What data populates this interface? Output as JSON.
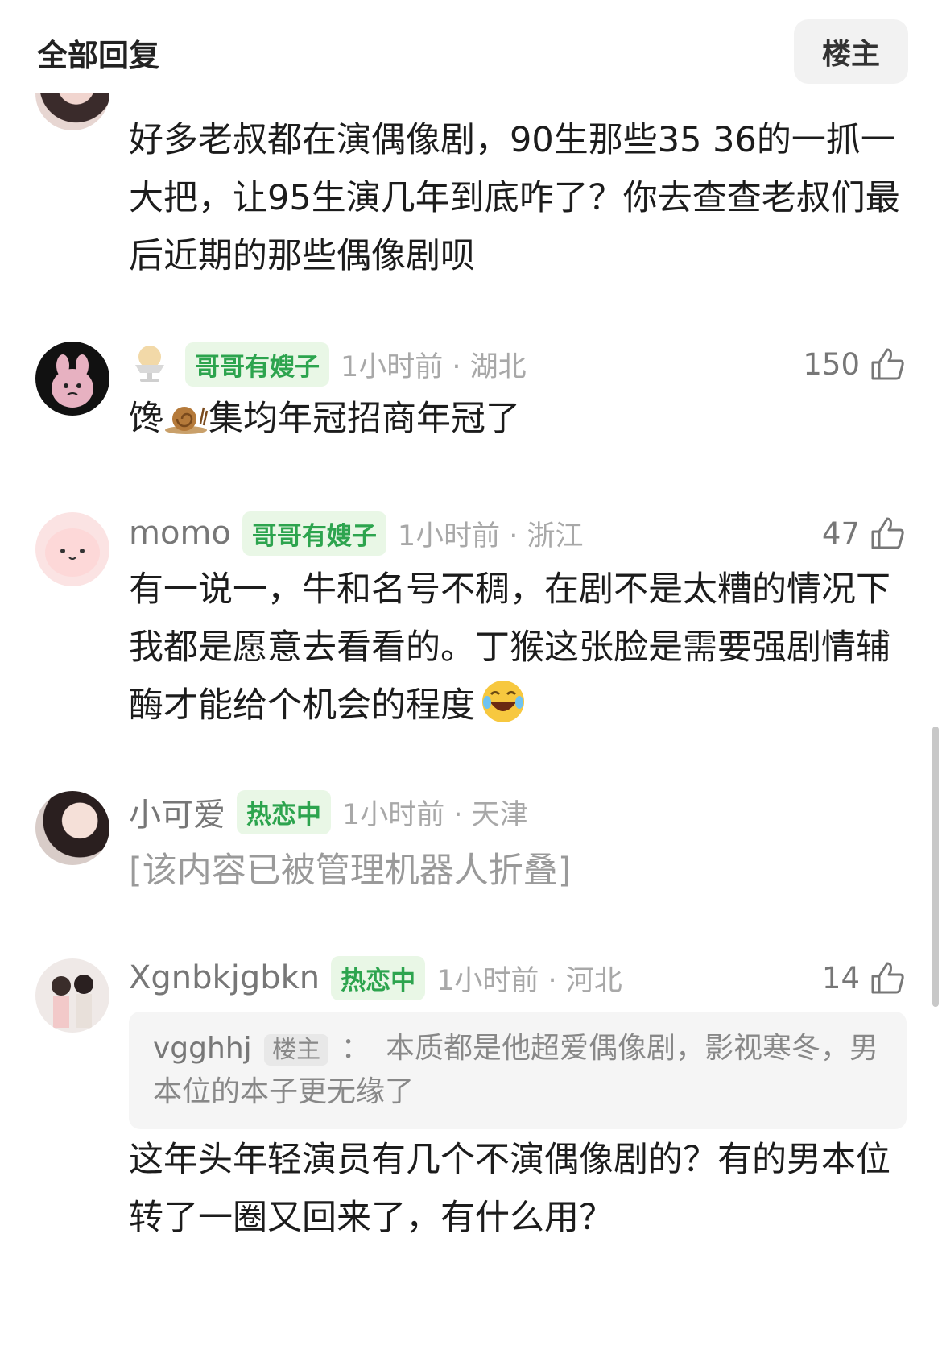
{
  "header": {
    "title": "全部回复",
    "op_button": "楼主"
  },
  "comments": [
    {
      "text": "好多老叔都在演偶像剧，90生那些35 36的一抓一大把，让95生演几年到底咋了？你去查查老叔们最后近期的那些偶像剧呗"
    },
    {
      "username": "",
      "tag": "哥哥有嫂子",
      "time_location": "1小时前 · 湖北",
      "likes": "150",
      "text_before": "馋",
      "text_after": "集均年冠招商年冠了"
    },
    {
      "username": "momo",
      "tag": "哥哥有嫂子",
      "time_location": "1小时前 · 浙江",
      "likes": "47",
      "text": "有一说一，牛和名号不稠，在剧不是太糟的情况下我都是愿意去看看的。丁猴这张脸是需要强剧情辅酶才能给个机会的程度"
    },
    {
      "username": "小可爱",
      "tag": "热恋中",
      "time_location": "1小时前 · 天津",
      "text": "[该内容已被管理机器人折叠]"
    },
    {
      "username": "Xgnbkjgbkn",
      "tag": "热恋中",
      "time_location": "1小时前 · 河北",
      "likes": "14",
      "quote": {
        "user": "vgghhj",
        "tag": "楼主",
        "colon": "：",
        "text": "本质都是他超爱偶像剧，影视寒冬，男本位的本子更无缘了"
      },
      "text": "这年头年轻演员有几个不演偶像剧的？有的男本位转了一圈又回来了，有什么用？"
    }
  ],
  "colors": {
    "tag_green": "#2da44e",
    "tag_bg": "#e9f7e6",
    "meta_gray": "#a8a8a8"
  }
}
